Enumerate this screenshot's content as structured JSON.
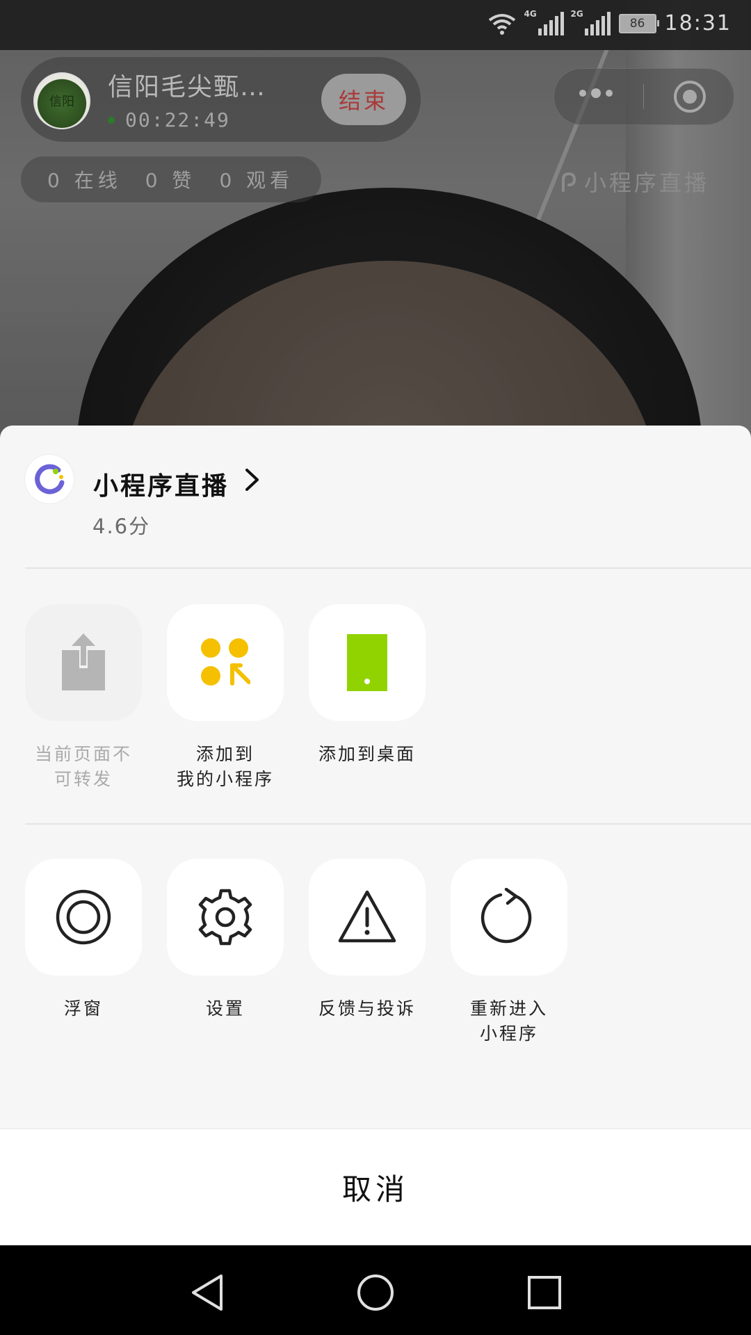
{
  "status_bar": {
    "network_1": "4G",
    "network_2": "2G",
    "battery": "86",
    "time": "18:31"
  },
  "live": {
    "anchor_name": "信阳毛尖甄…",
    "elapsed": "00:22:49",
    "end_label": "结束",
    "stats": [
      "0 在线",
      "0 赞",
      "0 观看"
    ],
    "watermark": "小程序直播"
  },
  "sheet": {
    "app_name": "小程序直播",
    "rating": "4.6分",
    "row1": [
      {
        "line1": "当前页面不",
        "line2": "可转发",
        "icon": "share-icon",
        "disabled": true
      },
      {
        "line1": "添加到",
        "line2": "我的小程序",
        "icon": "add-to-my-miniprogram-icon",
        "disabled": false
      },
      {
        "line1": "添加到桌面",
        "line2": "",
        "icon": "add-to-desktop-icon",
        "disabled": false
      }
    ],
    "row2": [
      {
        "line1": "浮窗",
        "line2": "",
        "icon": "floating-window-icon"
      },
      {
        "line1": "设置",
        "line2": "",
        "icon": "settings-gear-icon"
      },
      {
        "line1": "反馈与投诉",
        "line2": "",
        "icon": "warning-triangle-icon"
      },
      {
        "line1": "重新进入",
        "line2": "小程序",
        "icon": "reload-icon"
      }
    ],
    "cancel": "取消"
  },
  "colors": {
    "accent_yellow": "#F5C000",
    "accent_green": "#91D300",
    "logo_purple": "#6B62D8",
    "end_text": "#A93A3A"
  }
}
